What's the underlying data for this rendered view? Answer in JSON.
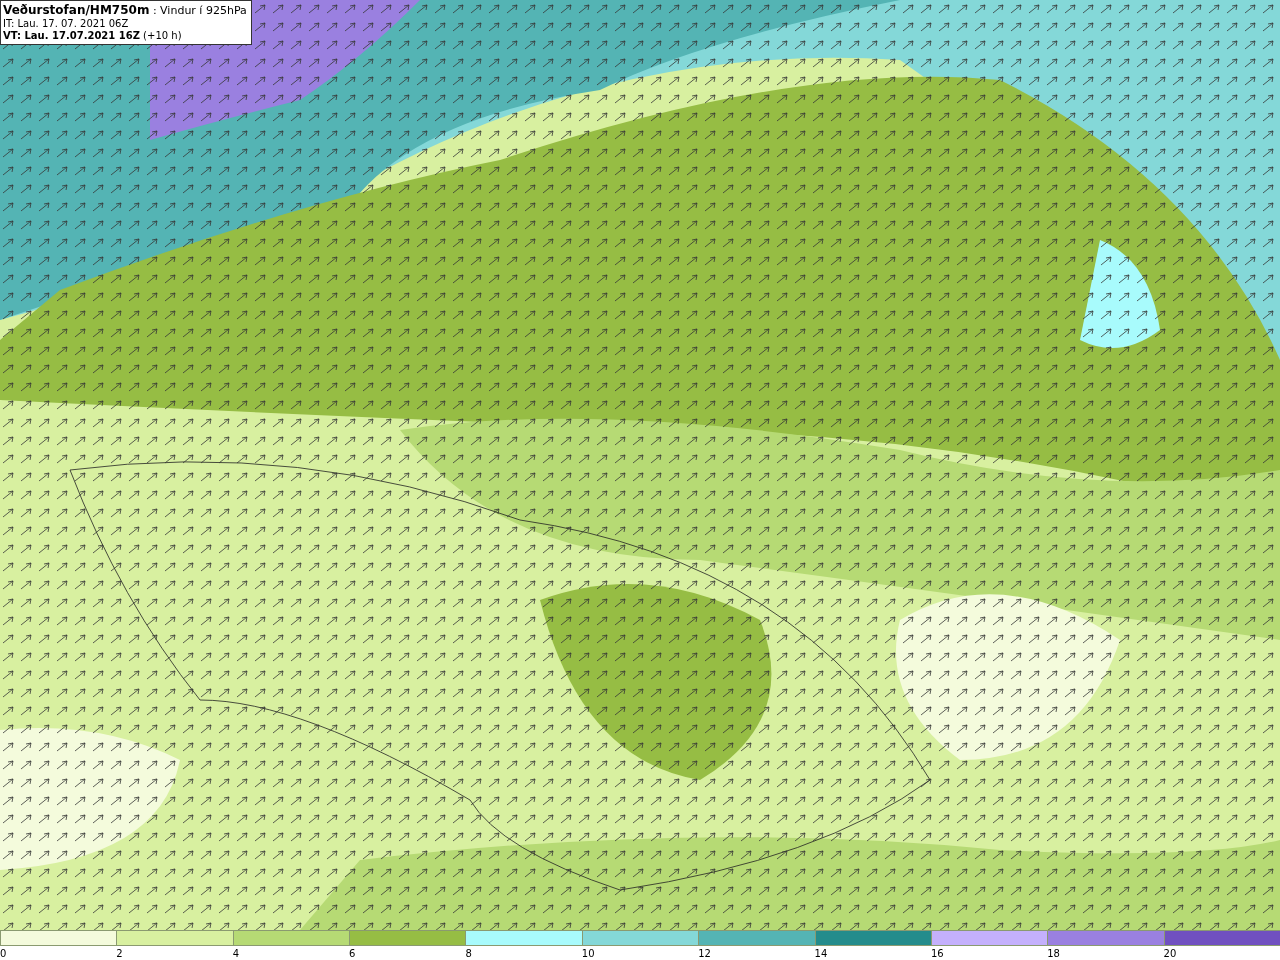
{
  "title_box": {
    "lines": [
      "**Veðurstofan/HM750m** : Vindur í 925hPa",
      "IT: Lau. 17. 07. 2021 06Z",
      "**VT: Lau. 17.07.2021 16Z** (+10 h)"
    ]
  },
  "legend": [
    {
      "label": "0",
      "color": "#f4fbdc"
    },
    {
      "label": "2",
      "color": "#d8f0a0"
    },
    {
      "label": "4",
      "color": "#b6da74"
    },
    {
      "label": "6",
      "color": "#96bd44"
    },
    {
      "label": "8",
      "color": "#a8fbfc"
    },
    {
      "label": "10",
      "color": "#84d8d8"
    },
    {
      "label": "12",
      "color": "#54b4b4"
    },
    {
      "label": "14",
      "color": "#248c8c"
    },
    {
      "label": "16",
      "color": "#c4b0fc"
    },
    {
      "label": "18",
      "color": "#9a80e0"
    },
    {
      "label": "20",
      "color": "#7050c0"
    }
  ]
}
